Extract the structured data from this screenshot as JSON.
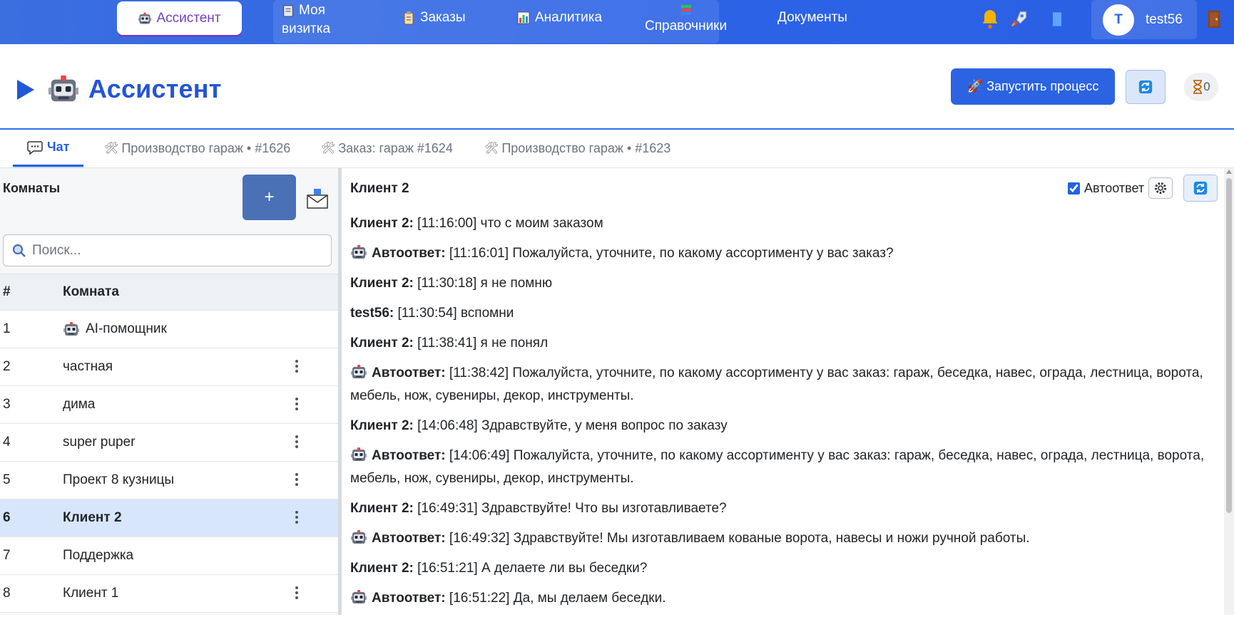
{
  "nav": {
    "assistant": "Ассистент",
    "card_line1": "Моя",
    "card_line2": "визитка",
    "orders": "Заказы",
    "analytics": "Аналитика",
    "directories": "Справочники",
    "documents": "Документы",
    "user_initial": "T",
    "user_name": "test56"
  },
  "header": {
    "title": "Ассистент",
    "launch_label": "🚀 Запустить процесс",
    "timer_count": "0"
  },
  "tabs": [
    {
      "label": "Чат",
      "icon": "chat-icon"
    },
    {
      "label": "Производство гараж • #1626",
      "icon": "tools-icon"
    },
    {
      "label": "Заказ: гараж #1624",
      "icon": "tools-icon"
    },
    {
      "label": "Производство гараж • #1623",
      "icon": "tools-icon"
    }
  ],
  "sidebar": {
    "title": "Комнаты",
    "add_label": "+",
    "search_placeholder": "Поиск...",
    "col_num": "#",
    "col_room": "Комната",
    "rows": [
      {
        "num": "1",
        "room": "AI-помощник"
      },
      {
        "num": "2",
        "room": "частная"
      },
      {
        "num": "3",
        "room": "дима"
      },
      {
        "num": "4",
        "room": "super puper"
      },
      {
        "num": "5",
        "room": "Проект 8 кузницы"
      },
      {
        "num": "6",
        "room": "Клиент 2"
      },
      {
        "num": "7",
        "room": "Поддержка"
      },
      {
        "num": "8",
        "room": "Клиент 1"
      }
    ]
  },
  "chat": {
    "title": "Клиент 2",
    "autoreply_label": "Автоответ",
    "messages": [
      {
        "author": "Клиент 2:",
        "time": "[11:16:00]",
        "text": "что с моим заказом"
      },
      {
        "author": "Автоответ:",
        "time": "[11:16:01]",
        "text": "Пожалуйста, уточните, по какому ассортименту у вас заказ?"
      },
      {
        "author": "Клиент 2:",
        "time": "[11:30:18]",
        "text": "я не помню"
      },
      {
        "author": "test56:",
        "time": "[11:30:54]",
        "text": "вспомни"
      },
      {
        "author": "Клиент 2:",
        "time": "[11:38:41]",
        "text": "я не понял"
      },
      {
        "author": "Автоответ:",
        "time": "[11:38:42]",
        "text": "Пожалуйста, уточните, по какому ассортименту у вас заказ: гараж, беседка, навес, ограда, лестница, ворота, мебель, нож, сувениры, декор, инструменты."
      },
      {
        "author": "Клиент 2:",
        "time": "[14:06:48]",
        "text": "Здравствуйте, у меня вопрос по заказу"
      },
      {
        "author": "Автоответ:",
        "time": "[14:06:49]",
        "text": "Пожалуйста, уточните, по какому ассортименту у вас заказ: гараж, беседка, навес, ограда, лестница, ворота, мебель, нож, сувениры, декор, инструменты."
      },
      {
        "author": "Клиент 2:",
        "time": "[16:49:31]",
        "text": "Здравствуйте! Что вы изготавливаете?"
      },
      {
        "author": "Автоответ:",
        "time": "[16:49:32]",
        "text": "Здравствуйте! Мы изготавливаем кованые ворота, навесы и ножи ручной работы."
      },
      {
        "author": "Клиент 2:",
        "time": "[16:51:21]",
        "text": "А делаете ли вы беседки?"
      },
      {
        "author": "Автоответ:",
        "time": "[16:51:22]",
        "text": "Да, мы делаем беседки."
      }
    ]
  },
  "colors": {
    "primary": "#2b63e2",
    "title": "#2454d8",
    "active_nav": "#6f42c1",
    "selected_row": "#d7e6fb"
  }
}
